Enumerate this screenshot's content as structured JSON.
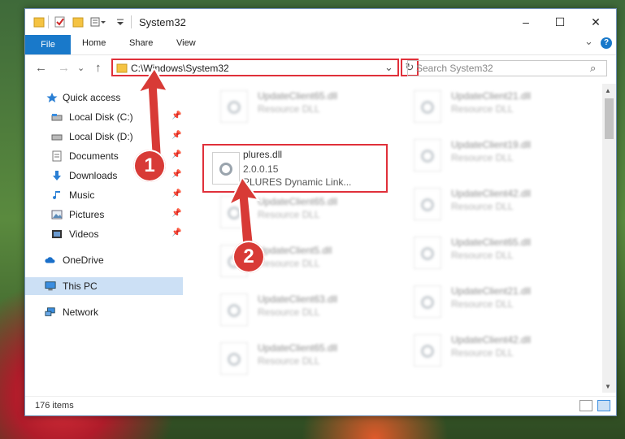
{
  "window": {
    "title": "System32",
    "controls": {
      "minimize": "–",
      "maximize": "☐",
      "close": "✕"
    }
  },
  "ribbon": {
    "tabs": [
      {
        "label": "File"
      },
      {
        "label": "Home"
      },
      {
        "label": "Share"
      },
      {
        "label": "View"
      }
    ],
    "expand_icon": "⌄",
    "help_icon": "?"
  },
  "navigation": {
    "back_icon": "←",
    "forward_icon": "→",
    "recent_icon": "⌄",
    "up_icon": "↑",
    "address": "C:\\Windows\\System32",
    "address_dropdown": "⌄",
    "refresh_icon": "↻",
    "search_placeholder": "Search System32",
    "search_icon": "⌕"
  },
  "sidebar": {
    "items": [
      {
        "label": "Quick access",
        "icon": "star-icon"
      },
      {
        "label": "Local Disk (C:)",
        "icon": "drive-icon"
      },
      {
        "label": "Local Disk (D:)",
        "icon": "drive-icon"
      },
      {
        "label": "Documents",
        "icon": "documents-icon"
      },
      {
        "label": "Downloads",
        "icon": "download-icon"
      },
      {
        "label": "Music",
        "icon": "music-icon"
      },
      {
        "label": "Pictures",
        "icon": "pictures-icon"
      },
      {
        "label": "Videos",
        "icon": "videos-icon"
      },
      {
        "label": "OneDrive",
        "icon": "cloud-icon"
      },
      {
        "label": "This PC",
        "icon": "computer-icon"
      },
      {
        "label": "Network",
        "icon": "network-icon"
      }
    ]
  },
  "files": [
    {
      "name": "UpdateClient65.dll",
      "type": "Resource DLL",
      "blurred": true
    },
    {
      "name": "UpdateClient21.dll",
      "type": "Resource DLL",
      "blurred": true
    },
    {
      "name": "plures.dll",
      "type": "2.0.0.15",
      "description": "PLURES Dynamic Link...",
      "blurred": false
    },
    {
      "name": "UpdateClient19.dll",
      "type": "Resource DLL",
      "blurred": true
    },
    {
      "name": "UpdateClient65.dll",
      "type": "Resource DLL",
      "blurred": true
    },
    {
      "name": "UpdateClient42.dll",
      "type": "Resource DLL",
      "blurred": true
    },
    {
      "name": "UpdateClient5.dll",
      "type": "Resource DLL",
      "blurred": true
    },
    {
      "name": "UpdateClient65.dll",
      "type": "Resource DLL",
      "blurred": true
    },
    {
      "name": "UpdateClient63.dll",
      "type": "Resource DLL",
      "blurred": true
    },
    {
      "name": "UpdateClient21.dll",
      "type": "Resource DLL",
      "blurred": true
    },
    {
      "name": "UpdateClient65.dll",
      "type": "Resource DLL",
      "blurred": true
    },
    {
      "name": "UpdateClient42.dll",
      "type": "Resource DLL",
      "blurred": true
    }
  ],
  "status": {
    "item_count": "176 items"
  },
  "annotations": {
    "step1": "1",
    "step2": "2",
    "color": "#d83a36"
  }
}
